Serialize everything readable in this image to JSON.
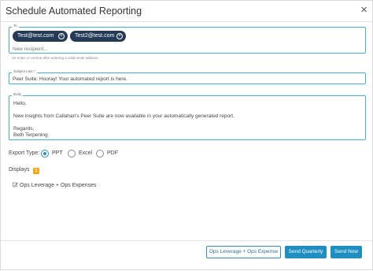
{
  "dialog": {
    "title": "Schedule Automated Reporting",
    "close_icon": "close-icon"
  },
  "to": {
    "label": "To",
    "recipients": [
      "Test@test.com",
      "Test2@test.com"
    ],
    "placeholder": "New recipient...",
    "hint": "Hit enter or comma after entering a valid email address"
  },
  "subject": {
    "label": "Subject Line *",
    "value": "Peer Suite: Hooray! Your automated report is here."
  },
  "body": {
    "label": "Body",
    "value": "Hello,\n\nNew insights from Callahan's Peer Suite are now available in your automatically generated report.\n\nRegards,\nBeth Terpening"
  },
  "export": {
    "label": "Export Type:",
    "options": [
      "PPT",
      "Excel",
      "PDF"
    ],
    "selected": "PPT"
  },
  "displays": {
    "label": "Displays",
    "count": "1",
    "items": [
      "Ops Leverage + Ops Expenses"
    ]
  },
  "footer": {
    "display_button": "Ops Leverage + Ops Expense",
    "send_quarterly": "Send Quarterly",
    "send_now": "Send Now"
  },
  "colors": {
    "accent": "#1f8fc2",
    "chip": "#243a57",
    "badge": "#f0a81a"
  }
}
